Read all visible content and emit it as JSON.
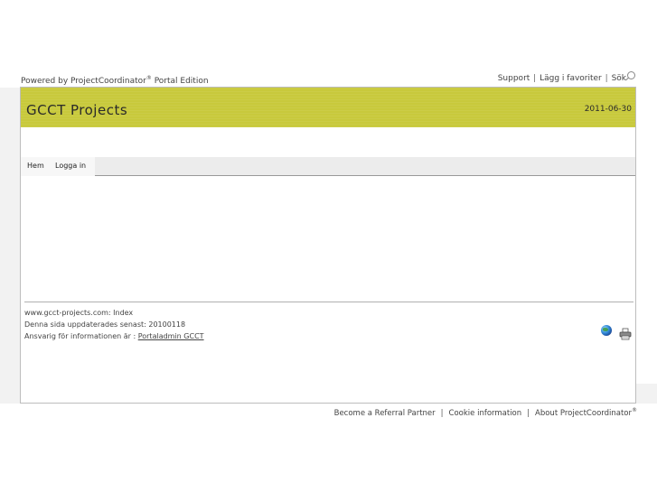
{
  "header": {
    "powered_prefix": "Powered by ProjectCoordinator",
    "powered_suffix": " Portal Edition",
    "registered": "®",
    "links": [
      "Support",
      "Lägg i favoriter",
      "Sök"
    ],
    "separator": "|"
  },
  "banner": {
    "title": "GCCT Projects",
    "date": "2011-06-30",
    "color": "#c8c93c"
  },
  "nav": {
    "items": [
      "Hem",
      "Logga in"
    ]
  },
  "footer": {
    "line1": "www.gcct-projects.com: Index",
    "line2": "Denna sida uppdaterades senast: 20100118",
    "line3_prefix": "Ansvarig för informationen är : ",
    "line3_link": "Portaladmin GCCT",
    "icons": [
      "globe-icon",
      "printer-icon"
    ]
  },
  "bottom_links": {
    "items": [
      "Become a Referral Partner",
      "Cookie information",
      "About ProjectCoordinator"
    ],
    "registered": "®",
    "separator": "|"
  }
}
